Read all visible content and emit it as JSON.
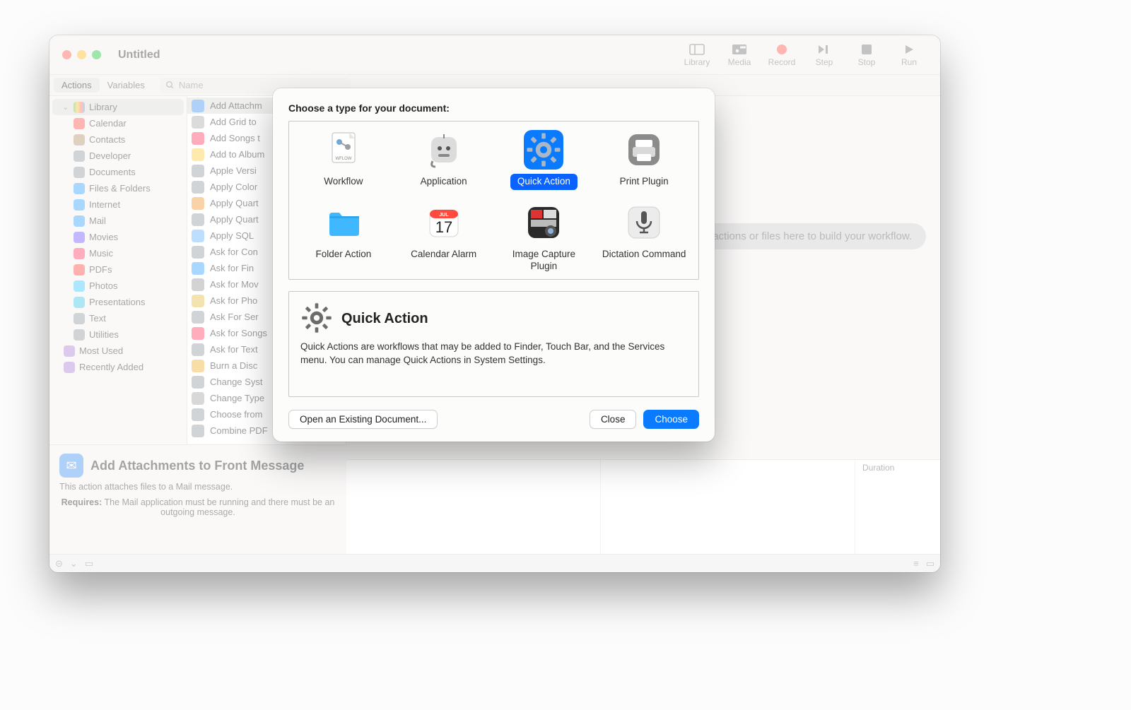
{
  "window": {
    "title": "Untitled"
  },
  "toolbar_buttons": [
    {
      "icon": "sidebar-icon",
      "label": "Library"
    },
    {
      "icon": "media-icon",
      "label": "Media"
    },
    {
      "icon": "record-icon",
      "label": "Record"
    },
    {
      "icon": "step-icon",
      "label": "Step"
    },
    {
      "icon": "stop-icon",
      "label": "Stop"
    },
    {
      "icon": "run-icon",
      "label": "Run"
    }
  ],
  "filter": {
    "tabs": [
      "Actions",
      "Variables"
    ],
    "active": 0,
    "search_placeholder": "Name"
  },
  "library": {
    "root": "Library",
    "items": [
      {
        "label": "Calendar",
        "color": "#ff5b52"
      },
      {
        "label": "Contacts",
        "color": "#b89a74"
      },
      {
        "label": "Developer",
        "color": "#9aa0a6"
      },
      {
        "label": "Documents",
        "color": "#9aa0a6"
      },
      {
        "label": "Files & Folders",
        "color": "#3fa7ff"
      },
      {
        "label": "Internet",
        "color": "#3fa7ff"
      },
      {
        "label": "Mail",
        "color": "#3fa7ff"
      },
      {
        "label": "Movies",
        "color": "#7a61ff"
      },
      {
        "label": "Music",
        "color": "#ff4a6b"
      },
      {
        "label": "PDFs",
        "color": "#ff564a"
      },
      {
        "label": "Photos",
        "color": "#48c7ff"
      },
      {
        "label": "Presentations",
        "color": "#4fc7e8"
      },
      {
        "label": "Text",
        "color": "#9aa0a6"
      },
      {
        "label": "Utilities",
        "color": "#9aa0a6"
      }
    ],
    "smart": [
      {
        "label": "Most Used",
        "color": "#b28bd9"
      },
      {
        "label": "Recently Added",
        "color": "#b28bd9"
      }
    ]
  },
  "actions": [
    "Add Attachments to Front Message",
    "Add Grid to PDF Documents",
    "Add Songs to Playlist",
    "Add to Album",
    "Apple Versioning Tool",
    "Apply ColorSync Profile to Images",
    "Apply Quartz Composition Filter to Image Files",
    "Apply Quartz Filter to PDF Documents",
    "Apply SQL",
    "Ask for Confirmation",
    "Ask for Finder Items",
    "Ask for Movies",
    "Ask for Photos",
    "Ask For Servers",
    "Ask for Songs",
    "Ask for Text",
    "Burn a Disc",
    "Change System Appearance",
    "Change Type of Images",
    "Choose from List",
    "Combine PDF Pages"
  ],
  "action_colors": [
    "#4e9af1",
    "#b0b0b0",
    "#ff4a6b",
    "#fdd04a",
    "#9aa0a6",
    "#9aa0a6",
    "#f49b3f",
    "#9aa0a6",
    "#6cb5ff",
    "#9aa0a6",
    "#3fa7ff",
    "#9e9e9e",
    "#e9c24e",
    "#9aa0a6",
    "#ff4a6b",
    "#9aa0a6",
    "#f0b63a",
    "#9aa0a6",
    "#a8a8a8",
    "#9aa0a6",
    "#9aa0a6"
  ],
  "actions_selected": 0,
  "description": {
    "title": "Add Attachments to Front Message",
    "body": "This action attaches files to a Mail message.",
    "requires_label": "Requires:",
    "requires": "The Mail application must be running and there must be an outgoing message."
  },
  "canvas": {
    "hint": "Drag actions or files here to build your workflow.",
    "columns": [
      "",
      "",
      "Duration"
    ]
  },
  "sheet": {
    "heading": "Choose a type for your document:",
    "types": [
      {
        "label": "Workflow"
      },
      {
        "label": "Application"
      },
      {
        "label": "Quick Action"
      },
      {
        "label": "Print Plugin"
      },
      {
        "label": "Folder Action"
      },
      {
        "label": "Calendar Alarm"
      },
      {
        "label": "Image Capture Plugin"
      },
      {
        "label": "Dictation Command"
      }
    ],
    "selected": 2,
    "info": {
      "title": "Quick Action",
      "body": "Quick Actions are workflows that may be added to Finder, Touch Bar, and the Services menu. You can manage Quick Actions in System Settings."
    },
    "buttons": {
      "open": "Open an Existing Document...",
      "close": "Close",
      "choose": "Choose"
    }
  }
}
